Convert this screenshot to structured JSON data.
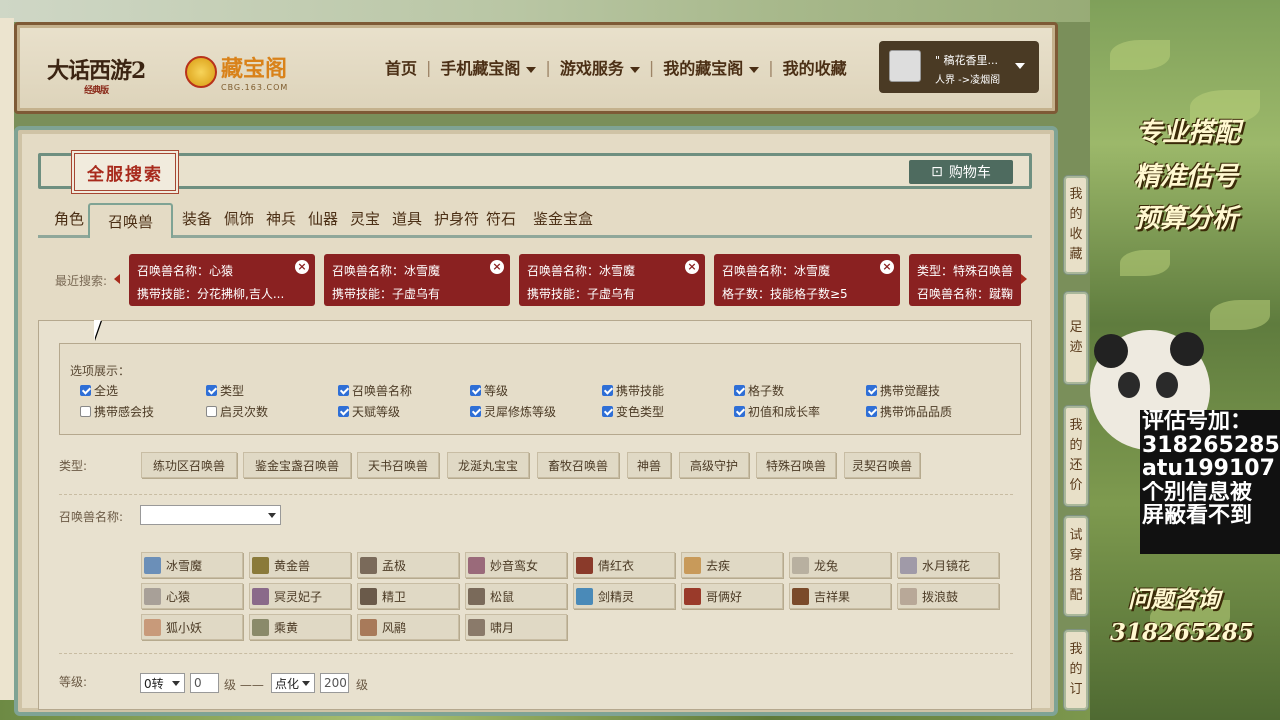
{
  "header": {
    "logo_game": "大话西游2",
    "logo_game_sub": "经典版",
    "logo_site": "藏宝阁",
    "logo_site_sub": "CBG.163.COM",
    "nav": [
      {
        "label": "首页",
        "dropdown": false
      },
      {
        "label": "手机藏宝阁",
        "dropdown": true
      },
      {
        "label": "游戏服务",
        "dropdown": true
      },
      {
        "label": "我的藏宝阁",
        "dropdown": true
      },
      {
        "label": "我的收藏",
        "dropdown": false
      }
    ],
    "user": {
      "name": "\" 稿花香里...",
      "location": "人界 ->凌烟阁"
    }
  },
  "search": {
    "title": "全服搜索",
    "cart": "购物车",
    "tabs": [
      "角色",
      "召唤兽",
      "装备",
      "佩饰",
      "神兵",
      "仙器",
      "灵宝",
      "道具",
      "护身符",
      "符石",
      "鉴金宝盒"
    ],
    "active_tab": "召唤兽",
    "recent_label": "最近搜索:",
    "recent": [
      {
        "line1": "召唤兽名称：心猿",
        "line2": "携带技能：分花拂柳,吉人..."
      },
      {
        "line1": "召唤兽名称：冰雪魔",
        "line2": "携带技能：子虚乌有"
      },
      {
        "line1": "召唤兽名称：冰雪魔",
        "line2": "携带技能：子虚乌有"
      },
      {
        "line1": "召唤兽名称：冰雪魔",
        "line2": "格子数：技能格子数≥5"
      },
      {
        "line1": "类型：特殊召唤兽",
        "line2": "召唤兽名称：蹴鞠"
      }
    ]
  },
  "options": {
    "title": "选项展示：",
    "items": [
      {
        "label": "全选",
        "checked": true
      },
      {
        "label": "类型",
        "checked": true
      },
      {
        "label": "召唤兽名称",
        "checked": true
      },
      {
        "label": "等级",
        "checked": true
      },
      {
        "label": "携带技能",
        "checked": true
      },
      {
        "label": "格子数",
        "checked": true
      },
      {
        "label": "携带觉醒技",
        "checked": true
      },
      {
        "label": "携带感会技",
        "checked": false
      },
      {
        "label": "启灵次数",
        "checked": false
      },
      {
        "label": "天赋等级",
        "checked": true
      },
      {
        "label": "灵犀修炼等级",
        "checked": true
      },
      {
        "label": "变色类型",
        "checked": true
      },
      {
        "label": "初值和成长率",
        "checked": true
      },
      {
        "label": "携带饰品品质",
        "checked": true
      }
    ]
  },
  "filters": {
    "type_label": "类型:",
    "types": [
      "练功区召唤兽",
      "鉴金宝盏召唤兽",
      "天书召唤兽",
      "龙涎丸宝宝",
      "畜牧召唤兽",
      "神兽",
      "高级守护",
      "特殊召唤兽",
      "灵契召唤兽"
    ],
    "name_label": "召唤兽名称:",
    "name_value": "",
    "pets": [
      {
        "name": "冰雪魔",
        "color": "#6b8fb8"
      },
      {
        "name": "黄金兽",
        "color": "#8a7a3a"
      },
      {
        "name": "孟极",
        "color": "#7a6a5a"
      },
      {
        "name": "妙音鸾女",
        "color": "#9a6a7a"
      },
      {
        "name": "倩红衣",
        "color": "#8a3a2a"
      },
      {
        "name": "去疾",
        "color": "#c89a5a"
      },
      {
        "name": "龙兔",
        "color": "#b8b0a0"
      },
      {
        "name": "水月镜花",
        "color": "#a09aa8"
      },
      {
        "name": "心猿",
        "color": "#a8a098"
      },
      {
        "name": "冥灵妃子",
        "color": "#8a6a8a"
      },
      {
        "name": "精卫",
        "color": "#6a5a4a"
      },
      {
        "name": "松鼠",
        "color": "#7a6a5a"
      },
      {
        "name": "剑精灵",
        "color": "#4a8ab8"
      },
      {
        "name": "哥俩好",
        "color": "#9a3a2a"
      },
      {
        "name": "吉祥果",
        "color": "#7a4a2a"
      },
      {
        "name": "拨浪鼓",
        "color": "#b8a898"
      },
      {
        "name": "狐小妖",
        "color": "#c89a7a"
      },
      {
        "name": "乘黄",
        "color": "#8a8a6a"
      },
      {
        "name": "风鹝",
        "color": "#a87a5a"
      },
      {
        "name": "啸月",
        "color": "#8a7a6a"
      }
    ],
    "level_label": "等级:",
    "level_zhuan": "0转",
    "level_min": "0",
    "level_unit1": "级 ——",
    "level_type": "点化",
    "level_max": "200",
    "level_unit2": "级"
  },
  "sidebar_tabs": [
    "我的收藏",
    "足迹",
    "我的还价",
    "试穿搭配",
    "我的订"
  ],
  "promo": {
    "line1": "专业搭配",
    "line2": "精准估号",
    "line3": "预算分析",
    "contact": [
      "评估号加：",
      "318265285",
      "atu199107",
      "个别信息被",
      "屏蔽看不到"
    ],
    "ask_title": "问题咨询",
    "ask_number": "318265285"
  }
}
